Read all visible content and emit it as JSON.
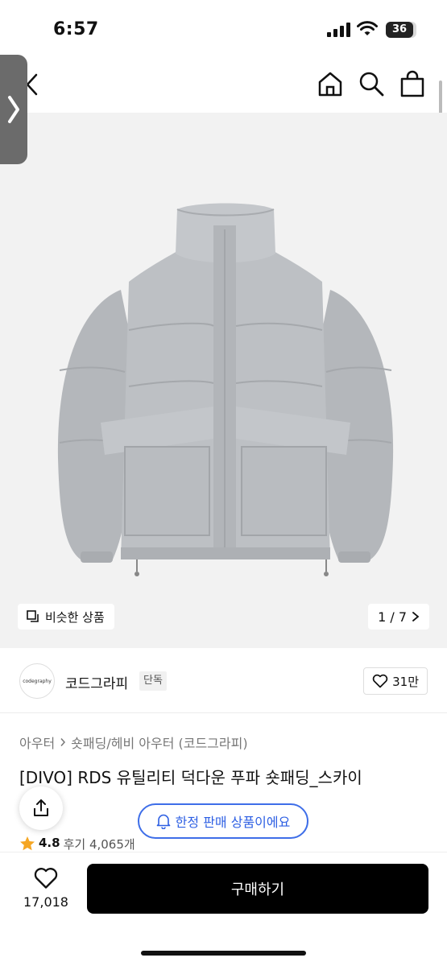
{
  "status_bar": {
    "time": "6:57",
    "battery": "36"
  },
  "hero": {
    "similar_label": "비슷한 상품",
    "page_indicator": "1 / 7"
  },
  "brand": {
    "logo_text": "codegraphy",
    "name": "코드그라피",
    "badge": "단독",
    "likes": "31만"
  },
  "breadcrumb": {
    "items": [
      "아우터",
      "숏패딩/헤비 아우터 (코드그라피)"
    ]
  },
  "product": {
    "title": "[DIVO] RDS 유틸리티 덕다운 푸파 숏패딩_스카이",
    "limited_banner": "한정 판매 상품이에요",
    "rating": "4.8",
    "reviews": "후기 4,065개"
  },
  "bottom_bar": {
    "wish_count": "17,018",
    "buy_label": "구매하기"
  },
  "colors": {
    "accent_blue": "#2d5fe3",
    "buy_button": "#000000",
    "star": "#f5a623",
    "jacket": "#b9bcc0"
  }
}
